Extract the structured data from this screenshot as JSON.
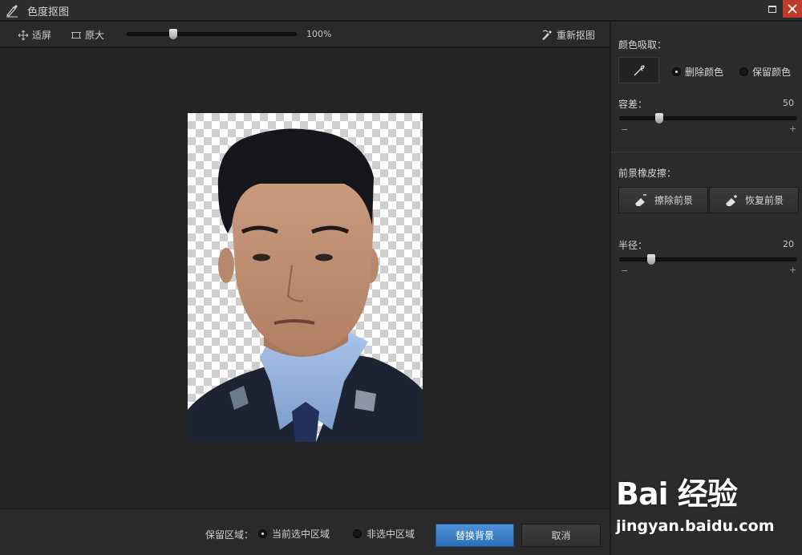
{
  "window": {
    "title": "色度抠图"
  },
  "toolbar": {
    "fit_label": "适屏",
    "original_label": "原大",
    "zoom_value": "100%",
    "zoom_fraction": 0.26,
    "reselect_label": "重新抠图"
  },
  "panel": {
    "color_pick_label": "颜色吸取：",
    "delete_color_label": "删除颜色",
    "keep_color_label": "保留颜色",
    "delete_color_selected": true,
    "tolerance_label": "容差：",
    "tolerance_value": "50",
    "tolerance_fraction": 0.21,
    "fg_eraser_label": "前景橡皮擦：",
    "erase_fg_label": "擦除前景",
    "restore_fg_label": "恢复前景",
    "radius_label": "半径：",
    "radius_value": "20",
    "radius_fraction": 0.16,
    "minus": "−",
    "plus": "+"
  },
  "bottom": {
    "keep_area_label": "保留区域：",
    "current_selection_label": "当前选中区域",
    "non_selection_label": "非选中区域",
    "current_selection_selected": true,
    "replace_bg_label": "替换背景",
    "cancel_label": "取消"
  },
  "watermark": {
    "logo_text": "Bai 经验",
    "site_text": "jingyan.baidu.com"
  },
  "colors": {
    "accent": "#3a7fc8",
    "close": "#c0392b",
    "panel_bg": "#2b2b2b",
    "canvas_bg": "#262626"
  }
}
